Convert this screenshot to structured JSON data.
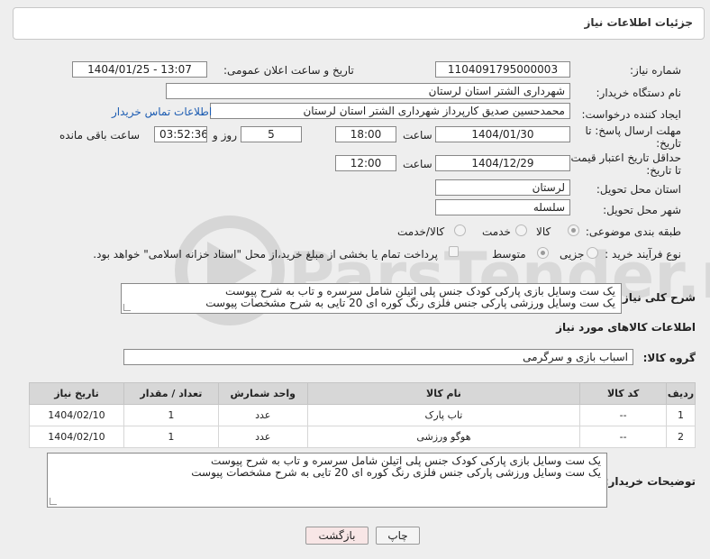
{
  "header": {
    "title": "جزئیات اطلاعات نیاز"
  },
  "fields": {
    "need_number_label": "شماره نیاز:",
    "need_number": "1104091795000003",
    "announce_label": "تاریخ و ساعت اعلان عمومی:",
    "announce_value": "1404/01/25 - 13:07",
    "buyer_org_label": "نام دستگاه خریدار:",
    "buyer_org": "شهرداری الشتر استان لرستان",
    "creator_label": "ایجاد کننده درخواست:",
    "creator": "محمدحسین صدیق کارپرداز شهرداری الشتر استان لرستان",
    "contact_link": "اطلاعات تماس خریدار",
    "reply_deadline_label_1": "مهلت ارسال پاسخ: تا",
    "reply_deadline_label_2": "تاریخ:",
    "reply_date": "1404/01/30",
    "time_label": "ساعت",
    "reply_time": "18:00",
    "days_value": "5",
    "days_label": "روز و",
    "remaining_time": "03:52:36",
    "remaining_label": "ساعت باقی مانده",
    "price_deadline_label_1": "حداقل تاریخ اعتبار قیمت:",
    "price_deadline_label_2": "تا تاریخ:",
    "price_date": "1404/12/29",
    "price_time": "12:00",
    "province_label": "استان محل تحویل:",
    "province": "لرستان",
    "city_label": "شهر محل تحویل:",
    "city": "سلسله",
    "category_label": "طبقه بندی موضوعی:",
    "category_options": [
      "کالا",
      "خدمت",
      "کالا/خدمت"
    ],
    "purchase_type_label": "نوع فرآیند خرید :",
    "purchase_type_options": [
      "جزیی",
      "متوسط"
    ],
    "payment_note": "پرداخت تمام یا بخشی از مبلغ خرید،از محل \"اسناد خزانه اسلامی\" خواهد بود.",
    "description_label": "شرح کلی نیاز:",
    "description_lines": [
      "یک ست وسایل بازی پارکی کودک جنس پلی اتیلن  شامل سرسره و تاب به شرح پیوست",
      "یک ست وسایل ورزشی پارکی جنس فلزی رنگ کوره ای 20 تایی به شرح مشخصات پیوست"
    ],
    "goods_info_title": "اطلاعات کالاهای مورد نیاز",
    "goods_group_label": "گروه کالا:",
    "goods_group": "اسباب بازی و سرگرمی"
  },
  "table": {
    "headers": [
      "ردیف",
      "کد کالا",
      "نام کالا",
      "واحد شمارش",
      "تعداد / مقدار",
      "تاریخ نیاز"
    ],
    "rows": [
      [
        "1",
        "--",
        "تاب پارک",
        "عدد",
        "1",
        "1404/02/10"
      ],
      [
        "2",
        "--",
        "هوگو ورزشی",
        "عدد",
        "1",
        "1404/02/10"
      ]
    ]
  },
  "buyer_notes": {
    "label": "توضیحات خریدار:",
    "lines": [
      "یک ست وسایل بازی پارکی کودک جنس پلی اتیلن  شامل سرسره و تاب به شرح پیوست",
      "یک ست وسایل ورزشی پارکی جنس فلزی رنگ کوره ای 20 تایی به شرح مشخصات پیوست"
    ]
  },
  "buttons": {
    "print": "چاپ",
    "back": "بازگشت"
  },
  "colors": {
    "link": "#1c5cb2",
    "back_button_bg": "#f8e6e6",
    "header_bg": "#d7d7d7"
  }
}
